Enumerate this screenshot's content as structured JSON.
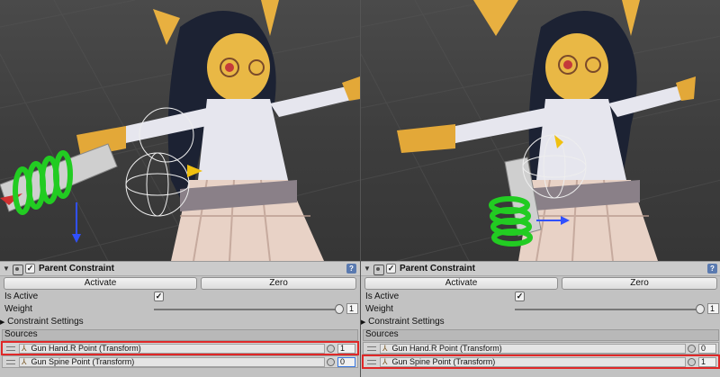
{
  "panels": [
    {
      "id": "left",
      "component": {
        "title": "Parent Constraint",
        "enabled_mark": "✓",
        "help": "?",
        "activate_label": "Activate",
        "zero_label": "Zero",
        "is_active_label": "Is Active",
        "is_active_mark": "✓",
        "weight_label": "Weight",
        "weight_value": "1",
        "settings_label": "Constraint Settings",
        "sources_label": "Sources",
        "sources": [
          {
            "name": "Gun Hand.R Point (Transform)",
            "weight": "1",
            "highlighted": true
          },
          {
            "name": "Gun Spine Point (Transform)",
            "weight": "0",
            "highlighted": false
          }
        ]
      }
    },
    {
      "id": "right",
      "component": {
        "title": "Parent Constraint",
        "enabled_mark": "✓",
        "help": "?",
        "activate_label": "Activate",
        "zero_label": "Zero",
        "is_active_label": "Is Active",
        "is_active_mark": "✓",
        "weight_label": "Weight",
        "weight_value": "1",
        "settings_label": "Constraint Settings",
        "sources_label": "Sources",
        "sources": [
          {
            "name": "Gun Hand.R Point (Transform)",
            "weight": "0",
            "highlighted": false
          },
          {
            "name": "Gun Spine Point (Transform)",
            "weight": "1",
            "highlighted": true
          }
        ]
      }
    }
  ],
  "icons": {
    "fold": "▼",
    "settings_fold": "▶",
    "transform_glyph": "⅄"
  },
  "colors": {
    "highlight": "#e02828",
    "gizmo_green": "#22cc22",
    "scene_bg": "#404040"
  }
}
